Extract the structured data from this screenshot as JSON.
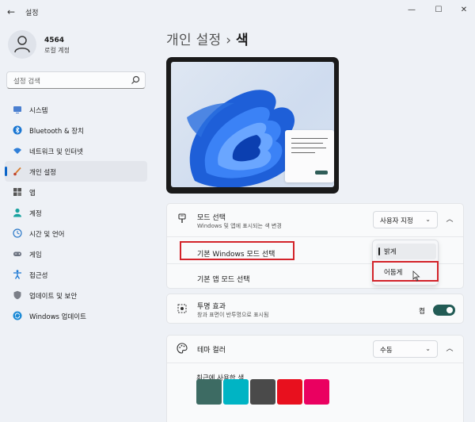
{
  "window": {
    "title": "설정",
    "back_glyph": "←",
    "minimize_glyph": "—",
    "maximize_glyph": "☐",
    "close_glyph": "✕"
  },
  "user": {
    "name": "4564",
    "account_type": "로컬 계정"
  },
  "search": {
    "placeholder": "설정 검색"
  },
  "sidebar": {
    "items": [
      {
        "label": "시스템",
        "icon": "monitor-icon"
      },
      {
        "label": "Bluetooth & 장치",
        "icon": "bluetooth-icon"
      },
      {
        "label": "네트워크 및 인터넷",
        "icon": "wifi-icon"
      },
      {
        "label": "개인 설정",
        "icon": "brush-icon",
        "active": true
      },
      {
        "label": "앱",
        "icon": "apps-icon"
      },
      {
        "label": "계정",
        "icon": "person-icon"
      },
      {
        "label": "시간 및 언어",
        "icon": "globe-clock-icon"
      },
      {
        "label": "게임",
        "icon": "gamepad-icon"
      },
      {
        "label": "접근성",
        "icon": "accessibility-icon"
      },
      {
        "label": "업데이트 및 보안",
        "icon": "shield-icon"
      },
      {
        "label": "Windows 업데이트",
        "icon": "sync-icon"
      }
    ]
  },
  "header": {
    "parent": "개인 설정",
    "separator": "›",
    "current": "색"
  },
  "mode_card": {
    "title": "모드 선택",
    "subtitle": "Windows 및 앱에 표시되는 색 변경",
    "dropdown_value": "사용자 지정",
    "windows_mode_label": "기본 Windows 모드 선택",
    "app_mode_label": "기본 앱 모드 선택",
    "menu_options": [
      "밝게",
      "어둡게"
    ],
    "menu_selected": "밝게",
    "menu_hovered": "어둡게"
  },
  "transparency_card": {
    "title": "투명 효과",
    "subtitle": "창과 표면이 반투명으로 표시됨",
    "toggle_label": "켬",
    "toggle_on": true
  },
  "accent_card": {
    "title": "테마 컬러",
    "dropdown_value": "수동",
    "recent_label": "최근에 사용한 색",
    "recent_colors": [
      "#3d6b63",
      "#00b4c4",
      "#4a4a4a",
      "#e8101e",
      "#ea0060"
    ]
  },
  "colors": {
    "accent": "#0a64c8",
    "toggle": "#225b55",
    "highlight_border": "#d3232a"
  }
}
